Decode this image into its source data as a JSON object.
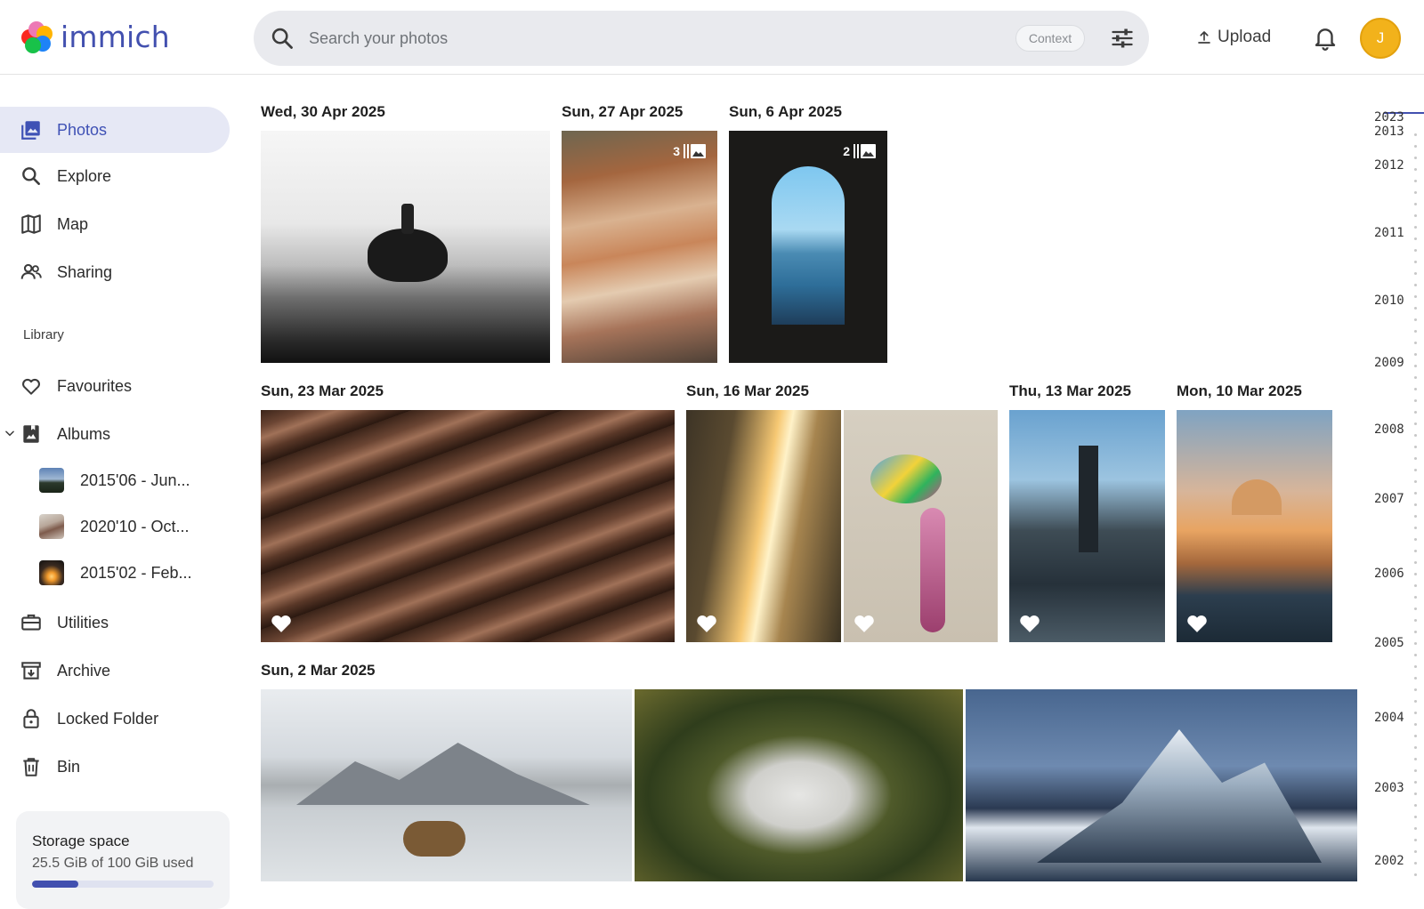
{
  "app": {
    "name": "immich",
    "brand_color": "#4250af"
  },
  "search": {
    "placeholder": "Search your photos",
    "chip": "Context"
  },
  "header": {
    "upload_label": "Upload",
    "avatar_initial": "J"
  },
  "sidebar": {
    "nav": [
      {
        "label": "Photos",
        "icon": "photos-icon",
        "active": true
      },
      {
        "label": "Explore",
        "icon": "search-icon"
      },
      {
        "label": "Map",
        "icon": "map-icon"
      },
      {
        "label": "Sharing",
        "icon": "people-icon"
      }
    ],
    "library_label": "Library",
    "library": [
      {
        "label": "Favourites",
        "icon": "heart-icon"
      },
      {
        "label": "Albums",
        "icon": "album-icon"
      }
    ],
    "albums": [
      {
        "label": "2015'06 - Jun..."
      },
      {
        "label": "2020'10 - Oct..."
      },
      {
        "label": "2015'02 - Feb..."
      }
    ],
    "more": [
      {
        "label": "Utilities",
        "icon": "toolbox-icon"
      },
      {
        "label": "Archive",
        "icon": "archive-icon"
      },
      {
        "label": "Locked Folder",
        "icon": "lock-icon"
      },
      {
        "label": "Bin",
        "icon": "trash-icon"
      }
    ],
    "storage": {
      "title": "Storage space",
      "used": "25.5 GiB of 100 GiB used",
      "fraction": 0.255
    }
  },
  "timeline": {
    "groups": [
      {
        "date": "Wed, 30 Apr 2025"
      },
      {
        "date": "Sun, 27 Apr 2025",
        "stack": "3"
      },
      {
        "date": "Sun, 6 Apr 2025",
        "stack": "2"
      },
      {
        "date": "Sun, 23 Mar 2025"
      },
      {
        "date": "Sun, 16 Mar 2025"
      },
      {
        "date": "Thu, 13 Mar 2025"
      },
      {
        "date": "Mon, 10 Mar 2025"
      },
      {
        "date": "Sun, 2 Mar 2025"
      }
    ]
  },
  "scrubber": {
    "years": [
      "2023",
      "2013",
      "2012",
      "2011",
      "2010",
      "2009",
      "2008",
      "2007",
      "2006",
      "2005",
      "2004",
      "2003",
      "2002"
    ]
  }
}
